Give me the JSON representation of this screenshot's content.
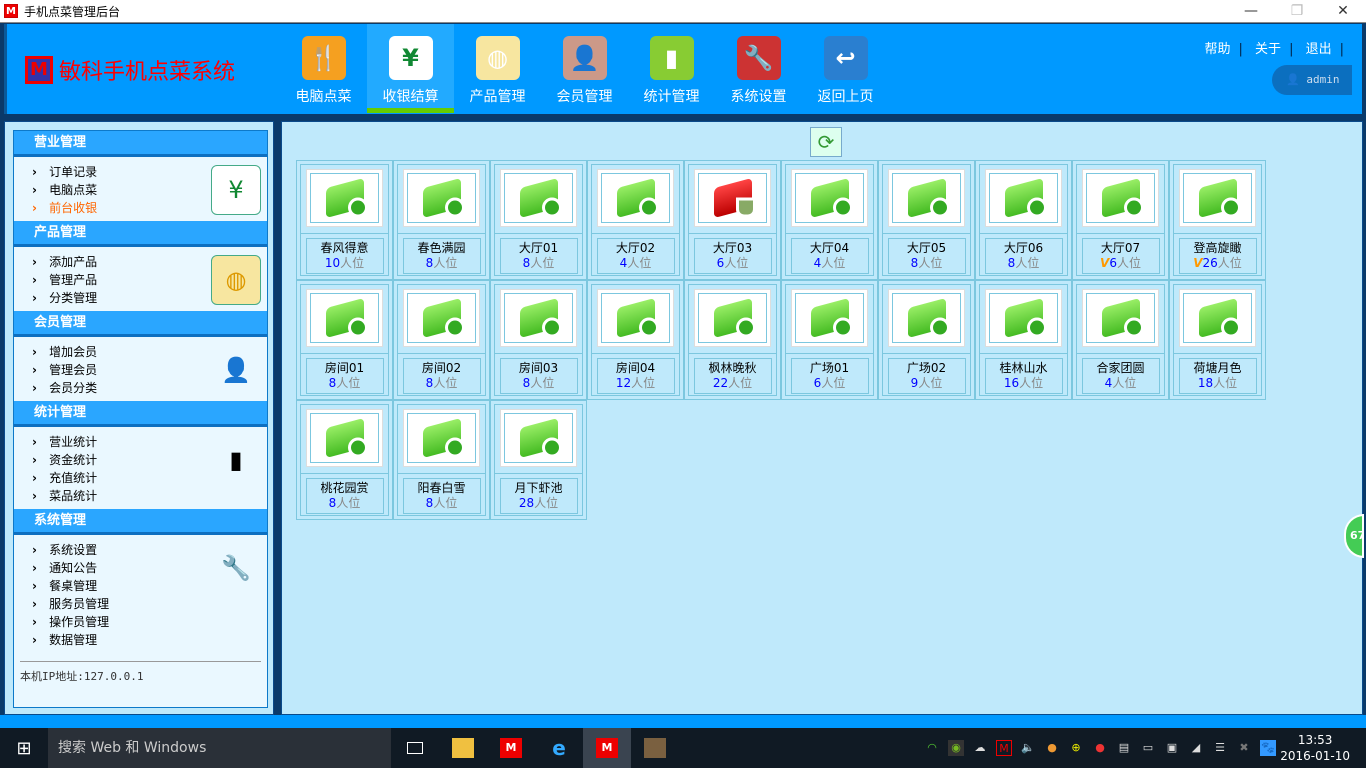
{
  "window": {
    "title": "手机点菜管理后台",
    "app_icon": "M"
  },
  "header": {
    "logo_text": "敏科手机点菜系统",
    "logo_icon": "M",
    "nav": [
      {
        "label": "电脑点菜",
        "icon": "menu-plate-icon",
        "color": "#f5a020"
      },
      {
        "label": "收银结算",
        "icon": "cashier-hand-icon",
        "color": "#ffffff",
        "active": true
      },
      {
        "label": "产品管理",
        "icon": "dumpling-basket-icon",
        "color": "#f7e6a0"
      },
      {
        "label": "会员管理",
        "icon": "member-person-icon",
        "color": "#c98"
      },
      {
        "label": "统计管理",
        "icon": "bar-chart-icon",
        "color": "#8c3"
      },
      {
        "label": "系统设置",
        "icon": "tools-icon",
        "color": "#c33"
      },
      {
        "label": "返回上页",
        "icon": "back-arrow-icon",
        "color": "#2a7fd0"
      }
    ],
    "links": [
      "帮助",
      "关于",
      "退出"
    ],
    "user": "admin"
  },
  "sidebar": {
    "sections": [
      {
        "title": "营业管理",
        "items": [
          "订单记录",
          "电脑点菜",
          "前台收银"
        ],
        "active": 2,
        "icon": "cashier-hand-icon"
      },
      {
        "title": "产品管理",
        "items": [
          "添加产品",
          "管理产品",
          "分类管理"
        ],
        "icon": "dumpling-basket-icon"
      },
      {
        "title": "会员管理",
        "items": [
          "增加会员",
          "管理会员",
          "会员分类"
        ],
        "icon": "member-person-icon"
      },
      {
        "title": "统计管理",
        "items": [
          "营业统计",
          "资金统计",
          "充值统计",
          "菜品统计"
        ],
        "icon": "bar-chart-icon"
      },
      {
        "title": "系统管理",
        "items": [
          "系统设置",
          "通知公告",
          "餐桌管理",
          "服务员管理",
          "操作员管理",
          "数据管理"
        ],
        "icon": "tools-icon"
      }
    ],
    "ip_label": "本机IP地址:127.0.0.1"
  },
  "tables": {
    "unit": "人位",
    "items": [
      {
        "name": "春风得意",
        "seats": "10",
        "status": "free"
      },
      {
        "name": "春色满园",
        "seats": "8",
        "status": "free"
      },
      {
        "name": "大厅01",
        "seats": "8",
        "status": "free"
      },
      {
        "name": "大厅02",
        "seats": "4",
        "status": "free"
      },
      {
        "name": "大厅03",
        "seats": "6",
        "status": "busy"
      },
      {
        "name": "大厅04",
        "seats": "4",
        "status": "free"
      },
      {
        "name": "大厅05",
        "seats": "8",
        "status": "free"
      },
      {
        "name": "大厅06",
        "seats": "8",
        "status": "free"
      },
      {
        "name": "大厅07",
        "seats": "6",
        "status": "free",
        "vip": "V"
      },
      {
        "name": "登高旋瞰",
        "seats": "26",
        "status": "free",
        "vip": "V"
      },
      {
        "name": "房间01",
        "seats": "8",
        "status": "free"
      },
      {
        "name": "房间02",
        "seats": "8",
        "status": "free"
      },
      {
        "name": "房间03",
        "seats": "8",
        "status": "free"
      },
      {
        "name": "房间04",
        "seats": "12",
        "status": "free"
      },
      {
        "name": "枫林晚秋",
        "seats": "22",
        "status": "free"
      },
      {
        "name": "广场01",
        "seats": "6",
        "status": "free"
      },
      {
        "name": "广场02",
        "seats": "9",
        "status": "free"
      },
      {
        "name": "桂林山水",
        "seats": "16",
        "status": "free"
      },
      {
        "name": "合家团圆",
        "seats": "4",
        "status": "free"
      },
      {
        "name": "荷塘月色",
        "seats": "18",
        "status": "free"
      },
      {
        "name": "桃花园赏",
        "seats": "8",
        "status": "free"
      },
      {
        "name": "阳春白雪",
        "seats": "8",
        "status": "free"
      },
      {
        "name": "月下虾池",
        "seats": "28",
        "status": "free"
      }
    ]
  },
  "side_badge": "67",
  "taskbar": {
    "search_placeholder": "搜索 Web 和 Windows",
    "time": "13:53",
    "date": "2016-01-10"
  }
}
